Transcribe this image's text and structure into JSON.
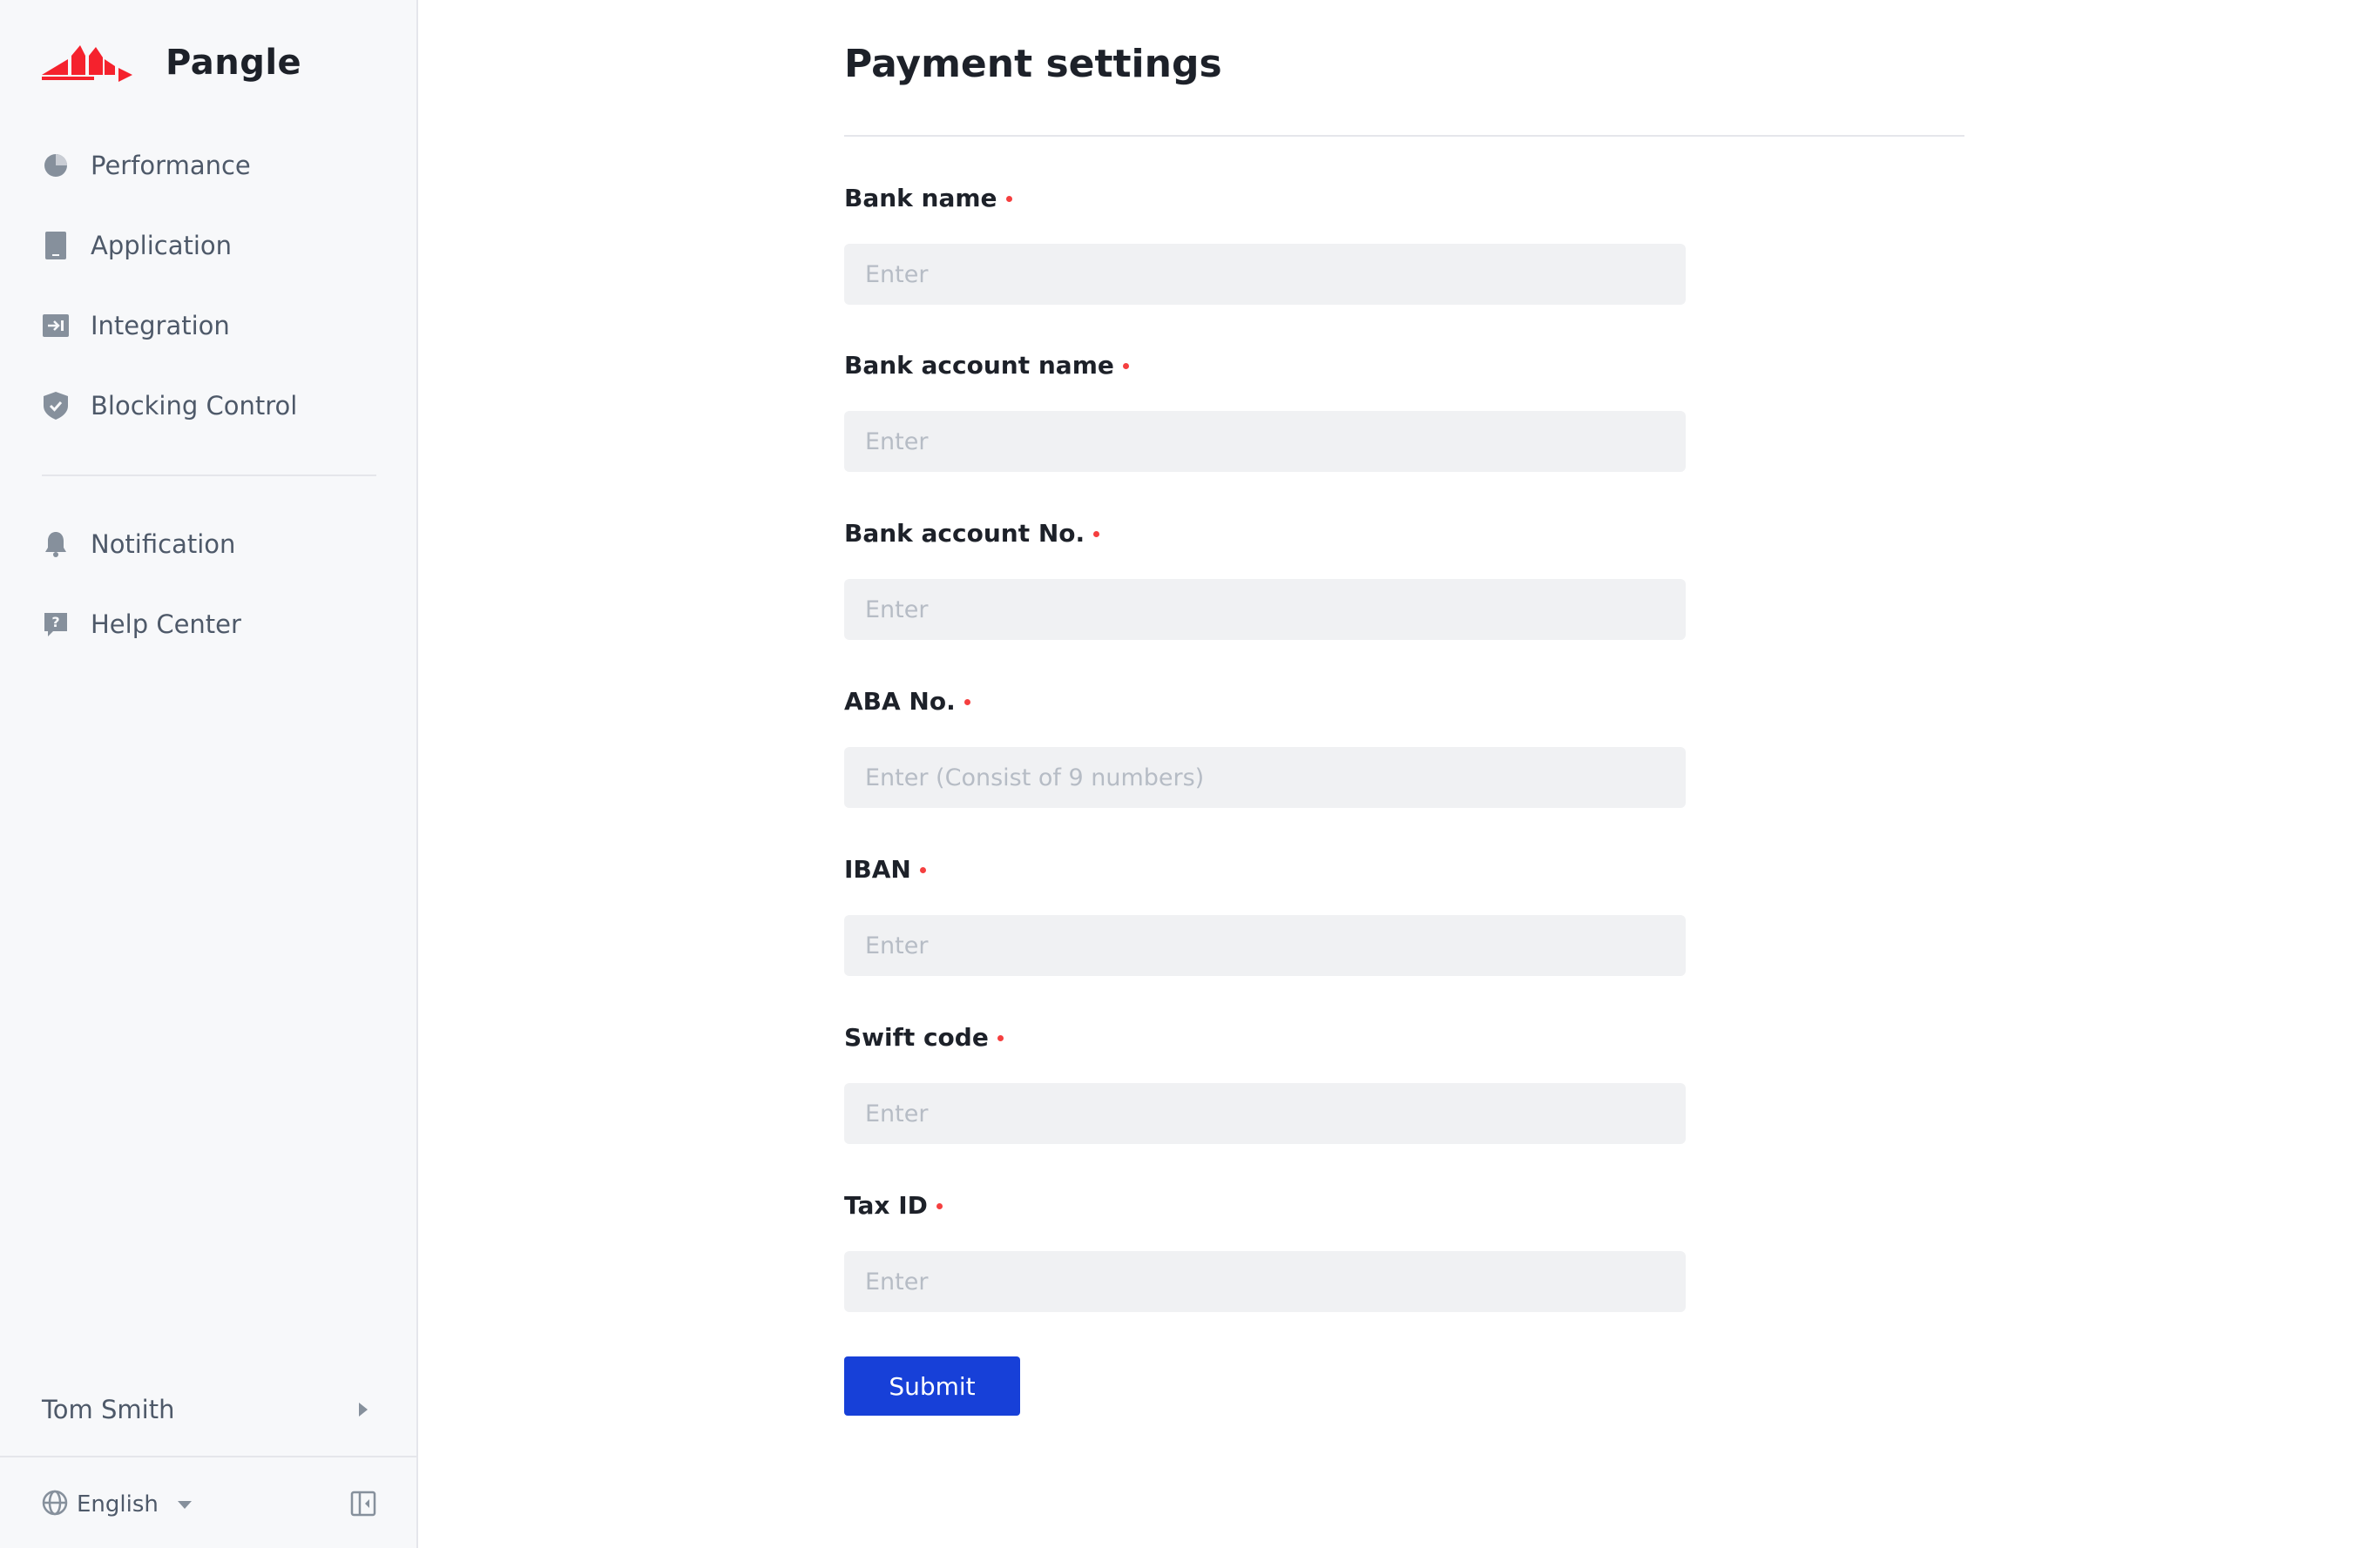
{
  "brand": {
    "name": "Pangle",
    "accent": "#f5222d",
    "primary": "#1740d8"
  },
  "sidebar": {
    "items": [
      {
        "label": "Performance",
        "icon": "pie-chart-icon"
      },
      {
        "label": "Application",
        "icon": "tablet-icon"
      },
      {
        "label": "Integration",
        "icon": "integration-arrow-icon"
      },
      {
        "label": "Blocking Control",
        "icon": "shield-check-icon"
      }
    ],
    "secondary_items": [
      {
        "label": "Notification",
        "icon": "bell-icon"
      },
      {
        "label": "Help Center",
        "icon": "help-question-icon"
      }
    ],
    "user": {
      "name": "Tom Smith"
    },
    "language": {
      "selected": "English"
    }
  },
  "main": {
    "title": "Payment settings",
    "fields": [
      {
        "label": "Bank name",
        "placeholder": "Enter",
        "value": ""
      },
      {
        "label": "Bank account name",
        "placeholder": "Enter",
        "value": ""
      },
      {
        "label": "Bank account No.",
        "placeholder": "Enter",
        "value": ""
      },
      {
        "label": "ABA No.",
        "placeholder": "Enter (Consist of 9 numbers)",
        "value": ""
      },
      {
        "label": "IBAN",
        "placeholder": "Enter",
        "value": ""
      },
      {
        "label": "Swift code",
        "placeholder": "Enter",
        "value": ""
      },
      {
        "label": "Tax ID",
        "placeholder": "Enter",
        "value": ""
      }
    ],
    "submit_label": "Submit"
  }
}
